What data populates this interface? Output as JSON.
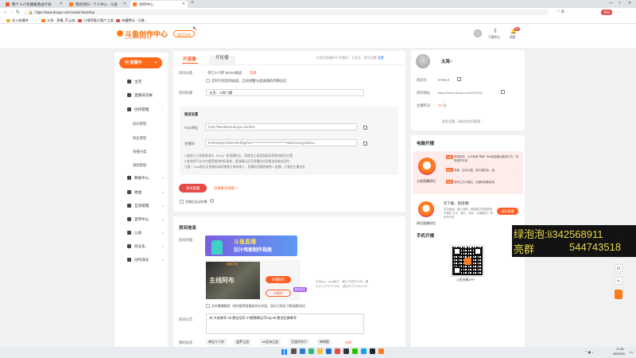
{
  "browser": {
    "tabs": [
      {
        "label": "两个十六年播报激战计划",
        "active": false,
        "color": "#e45a2c"
      },
      {
        "label": "我的资料 - 个人中心 - 斗鱼",
        "active": false,
        "color": "#ff7a1a"
      },
      {
        "label": "创作中心",
        "active": true,
        "color": "#ff7a1a"
      }
    ],
    "new_tab": "+",
    "address": "https://www.douyu.com/creator/main/live",
    "update_label": "更新",
    "window_controls": {
      "min": "—",
      "max": "□",
      "close": "✕"
    },
    "bookmarks": [
      {
        "label": "导入收藏夹"
      },
      {
        "label": "斗鱼 - 直播_不止游..."
      },
      {
        "label": "已推荐酷点客户工具..."
      },
      {
        "label": "有魔教坛 - 已推..."
      }
    ]
  },
  "header": {
    "logo_text": "斗鱼创作中心",
    "logo_sub": "DOUYU CREATOR CENTER",
    "home_button": "返回主站",
    "download_label": "下载中心",
    "message_label": "消息",
    "message_badge": "55"
  },
  "sidebar": {
    "live_button": "直播中",
    "items": [
      {
        "label": "主页",
        "icon": "home-icon"
      },
      {
        "label": "直播日志帐",
        "icon": "clipboard-icon"
      },
      {
        "label": "创作管理",
        "icon": "pen-icon",
        "expand": "^"
      },
      {
        "label": "数据中心",
        "icon": "chart-icon",
        "expand": "v"
      },
      {
        "label": "收益",
        "icon": "coin-icon",
        "expand": "v"
      },
      {
        "label": "互动管理",
        "icon": "chat-icon",
        "expand": "v"
      },
      {
        "label": "宣传中心",
        "icon": "megaphone-icon",
        "expand": "v"
      },
      {
        "label": "公会",
        "icon": "group-icon",
        "expand": "v"
      },
      {
        "label": "商业化",
        "icon": "bag-icon",
        "expand": "v"
      },
      {
        "label": "创作成长",
        "icon": "growth-icon",
        "expand": "v"
      }
    ],
    "subitems": [
      "房间管理",
      "粉丝管理",
      "直播分类",
      "视频管理"
    ]
  },
  "main": {
    "tabs": [
      "开直播",
      "开轮播"
    ],
    "notice": "在您如直播中不开播时 - 下台点，用可设置",
    "notice_link": "设置",
    "category_label": "房间分类",
    "category_value": "单元十六萨 BOSS挑战",
    "category_change": "选择",
    "auto_category": "实时识别游戏画面，自动调整分类直播的简略设在",
    "title_label": "房间标题",
    "title_value": "太亮：斗鱼门额",
    "push_section": "推流设置",
    "rtmp_label": "rtmp地址",
    "rtmp_value": "rtmp://sendtw3a.douyu.com/live",
    "code_label": "直播码",
    "code_value": "679418rwyCWsAOkHfDgPKo***************************&dtsnsvcsgnallow=",
    "notes": [
      "1.复制上方获取推流址（rtmp）和直播码后，到推流工具里面粘贴到推流相关位置",
      "2.推流时不允许在重置推流的标准参，要流确认好开直播码内容推流仅能成功时",
      "注意：rtmp地址及直播码请勿随意分享给他人，直播码泄露将被他人盗播，后果由主播自负"
    ],
    "close_button": "关闭直播",
    "switch_link": "切换推流线路 >",
    "autoplay_label": "关播后自动轮播",
    "room_info_title": "房间信息",
    "cover_label": "房间封面",
    "banner_title": "斗鱼直播",
    "banner_sub": "旧汁鸡客制作指南",
    "poster_tag": "横版封面",
    "poster_title": "主线阿布",
    "upload_button": "开播制作",
    "ai_button": "AI图片",
    "ai_badge": "推荐使用",
    "cover_hint": "支持jpg、png格式，最大不超过10M，最大尺寸不小于1280，建议尺寸1280x720",
    "live_cover_label": "实时播播截图（首时推荐直播画作在封面，现在已经给了解直播间封）",
    "announce_label": "房间公告",
    "announce_value": "s5 大地拳军  s6 需龙冠军  s7蒙腾降运币org s8 需龙乱舞拳军",
    "tags_label": "我的标签",
    "tags": [
      "单议十六岁",
      "盆萨之战",
      "lol亚洲之战",
      "天涯传亦只",
      "神明限"
    ],
    "tags_more": "选择"
  },
  "right": {
    "username": "太亮~",
    "room_no_label": "房间号",
    "room_no": "679418",
    "room_url_label": "房间地址",
    "room_url": "https://www.douyu.com/679418",
    "level_label": "主播积分",
    "level_value": "12",
    "level_unit": "分",
    "more_link": "更多设置、请前往房间管理 >",
    "pc_live_title": "电脑开播",
    "pc_app_name": "斗鱼直播伴侣",
    "pc_features": [
      {
        "tag": "功能",
        "text": "简明高效、大众玩家\"简单\" Mac版直播功能进行中。体现更好外观"
      },
      {
        "tag": "玩乐",
        "text": "录播、互动以图、音乐播放及，画、"
      },
      {
        "tag": "特权",
        "text": "操作立方对播后，交通特权都能用"
      }
    ],
    "web_live_title": "有下载、直接播！",
    "web_live_desc": "支持画面、图片选模，画模模式体验最强可播放 文字、图片、音乐（点播模式）等信号有效",
    "web_app_name": "网页直播伴侣",
    "web_live_button": "网页直播",
    "mobile_title": "手机开播",
    "qr_caption": "斗鱼直播APP"
  },
  "watermark": {
    "line1": "绿泡泡:li342568911",
    "line2_a": "亮群",
    "line2_b": "544743518"
  },
  "taskbar": {
    "time": "17:35",
    "date": "2023/9/4"
  }
}
